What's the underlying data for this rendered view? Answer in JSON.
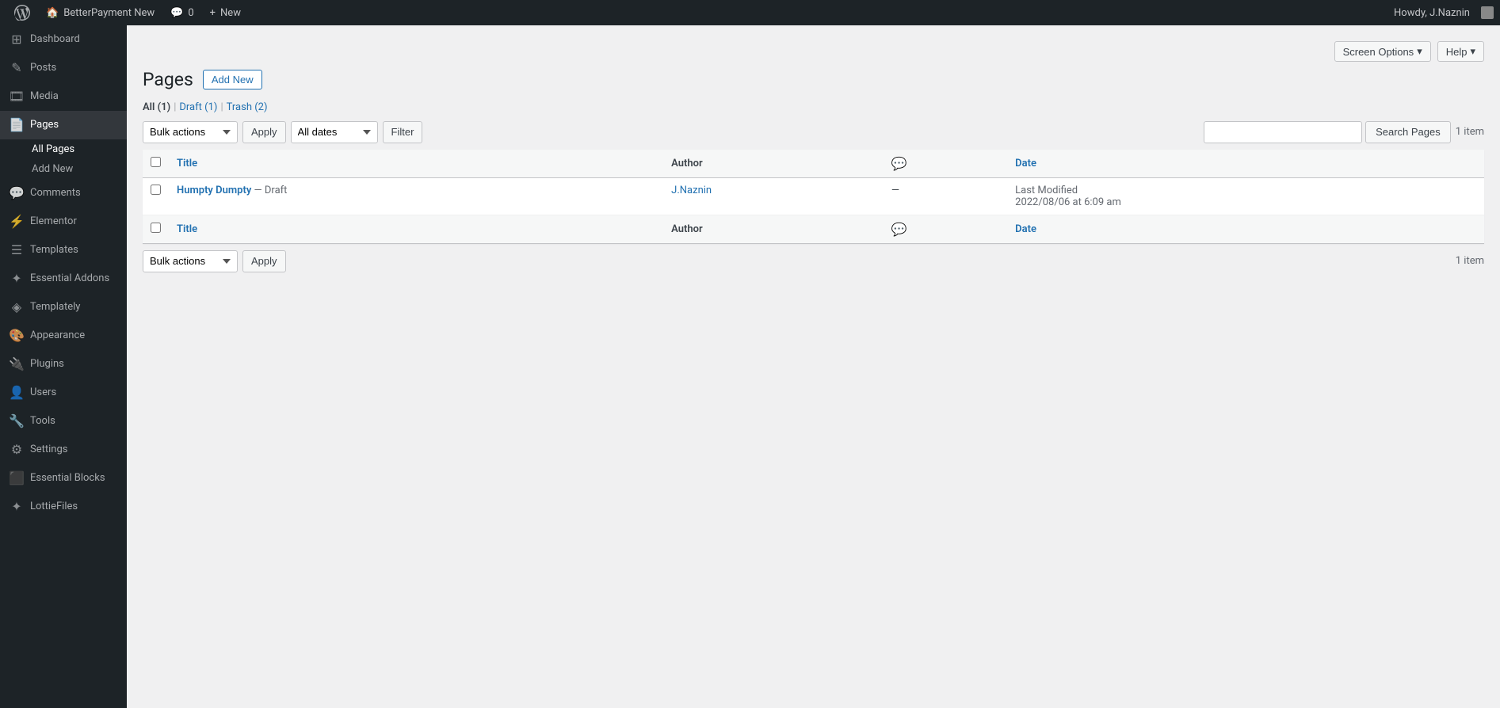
{
  "adminbar": {
    "site_name": "BetterPayment New",
    "comments_count": "0",
    "new_label": "New",
    "howdy": "Howdy, J.Naznin"
  },
  "top_buttons": {
    "screen_options": "Screen Options",
    "help": "Help"
  },
  "page": {
    "title": "Pages",
    "add_new": "Add New"
  },
  "filter_links": {
    "all_label": "All",
    "all_count": "(1)",
    "draft_label": "Draft",
    "draft_count": "(1)",
    "trash_label": "Trash",
    "trash_count": "(2)"
  },
  "toolbar_top": {
    "bulk_actions_label": "Bulk actions",
    "apply_label": "Apply",
    "all_dates_label": "All dates",
    "filter_label": "Filter",
    "item_count": "1 item",
    "search_pages_label": "Search Pages"
  },
  "toolbar_bottom": {
    "bulk_actions_label": "Bulk actions",
    "apply_label": "Apply",
    "item_count": "1 item"
  },
  "table": {
    "col_title": "Title",
    "col_author": "Author",
    "col_comments": "💬",
    "col_date": "Date",
    "rows": [
      {
        "title": "Humpty Dumpty",
        "draft_label": "— Draft",
        "author": "J.Naznin",
        "comments": "—",
        "date_label": "Last Modified",
        "date_value": "2022/08/06 at 6:09 am"
      }
    ]
  },
  "sidebar": {
    "items": [
      {
        "id": "dashboard",
        "label": "Dashboard",
        "icon": "⊞"
      },
      {
        "id": "posts",
        "label": "Posts",
        "icon": "✎"
      },
      {
        "id": "media",
        "label": "Media",
        "icon": "🎞"
      },
      {
        "id": "pages",
        "label": "Pages",
        "icon": "📄",
        "active": true
      },
      {
        "id": "comments",
        "label": "Comments",
        "icon": "💬"
      },
      {
        "id": "elementor",
        "label": "Elementor",
        "icon": "⚡"
      },
      {
        "id": "templates",
        "label": "Templates",
        "icon": "☰"
      },
      {
        "id": "essential-addons",
        "label": "Essential Addons",
        "icon": "✦"
      },
      {
        "id": "templately",
        "label": "Templately",
        "icon": "◈"
      },
      {
        "id": "appearance",
        "label": "Appearance",
        "icon": "🎨"
      },
      {
        "id": "plugins",
        "label": "Plugins",
        "icon": "🔌"
      },
      {
        "id": "users",
        "label": "Users",
        "icon": "👤"
      },
      {
        "id": "tools",
        "label": "Tools",
        "icon": "🔧"
      },
      {
        "id": "settings",
        "label": "Settings",
        "icon": "⚙"
      },
      {
        "id": "essential-blocks",
        "label": "Essential Blocks",
        "icon": "⬛"
      },
      {
        "id": "lottiefiles",
        "label": "LottieFiles",
        "icon": "✦"
      }
    ],
    "sub_items": [
      {
        "id": "all-pages",
        "label": "All Pages",
        "active": true
      },
      {
        "id": "add-new",
        "label": "Add New"
      }
    ]
  }
}
